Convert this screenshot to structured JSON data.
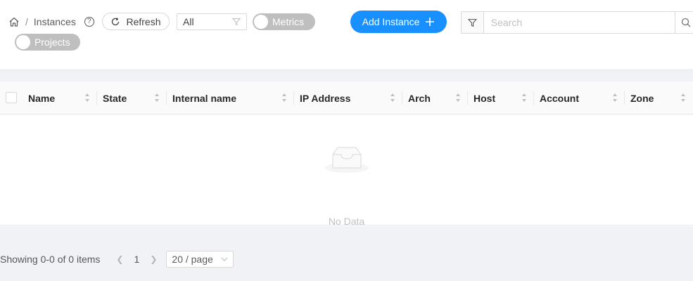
{
  "breadcrumb": {
    "current": "Instances",
    "separator": "/"
  },
  "toolbar": {
    "refresh_label": "Refresh",
    "filter_select_value": "All",
    "metrics_label": "Metrics",
    "projects_label": "Projects",
    "add_label": "Add Instance",
    "search_placeholder": "Search"
  },
  "table": {
    "columns": [
      "Name",
      "State",
      "Internal name",
      "IP Address",
      "Arch",
      "Host",
      "Account",
      "Zone"
    ],
    "empty_text": "No Data"
  },
  "pagination": {
    "total_text": "Showing 0-0 of 0 items",
    "page": "1",
    "page_size": "20 / page"
  },
  "colors": {
    "primary": "#1890ff",
    "switch_off": "#bfbfbf"
  }
}
